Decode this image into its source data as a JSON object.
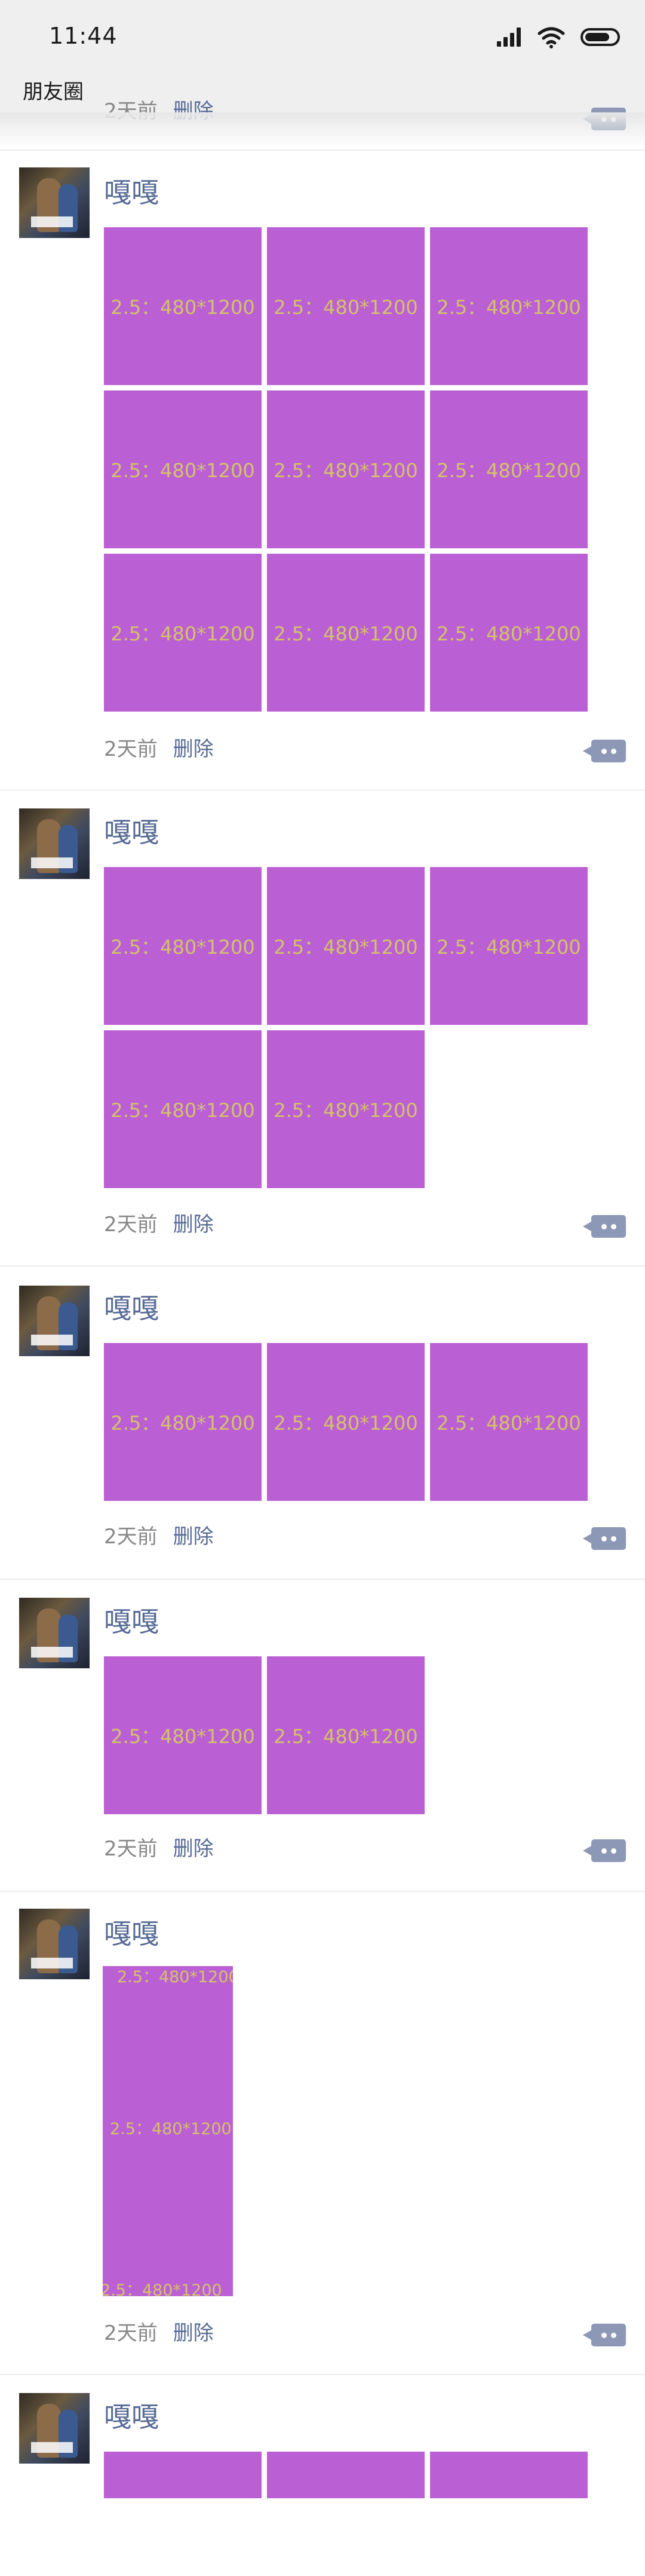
{
  "status_bar": {
    "time": "11:44"
  },
  "navbar": {
    "title": "朋友圈"
  },
  "partial_post": {
    "time_text": "2天前",
    "delete_label": "删除"
  },
  "image_placeholder": "2.5：480*1200",
  "posts": [
    {
      "author": "嘎嘎",
      "image_count": 9,
      "time_text": "2天前",
      "delete_label": "删除"
    },
    {
      "author": "嘎嘎",
      "image_count": 5,
      "time_text": "2天前",
      "delete_label": "删除"
    },
    {
      "author": "嘎嘎",
      "image_count": 3,
      "time_text": "2天前",
      "delete_label": "删除"
    },
    {
      "author": "嘎嘎",
      "image_count": 2,
      "time_text": "2天前",
      "delete_label": "删除"
    },
    {
      "author": "嘎嘎",
      "image_count": 1,
      "time_text": "2天前",
      "delete_label": "删除"
    },
    {
      "author": "嘎嘎",
      "image_count": 3
    }
  ],
  "colors": {
    "name": "#576b95",
    "image_placeholder_bg": "#bb60d4",
    "placeholder_text": "#d4c26a",
    "meta_text": "#888888",
    "comment_button": "#8c98b5"
  },
  "icons": {
    "signal": "signal-icon",
    "wifi": "wifi-icon",
    "battery": "battery-icon",
    "comment": "comment-icon"
  }
}
